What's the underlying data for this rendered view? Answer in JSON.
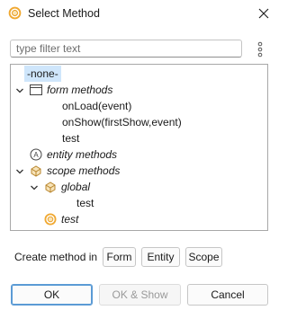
{
  "window": {
    "title": "Select Method",
    "close_icon": "close-icon",
    "app_icon": "ring-icon"
  },
  "filter": {
    "placeholder": "type filter text",
    "value": ""
  },
  "tree": {
    "none": "-none-",
    "form_methods": "form methods",
    "on_load": "onLoad(event)",
    "on_show": "onShow(firstShow,event)",
    "form_test": "test",
    "entity_methods": "entity methods",
    "scope_methods": "scope methods",
    "global": "global",
    "global_test": "test",
    "root_test": "test"
  },
  "create": {
    "label": "Create method in",
    "form": "Form",
    "entity": "Entity",
    "scope": "Scope"
  },
  "footer": {
    "ok": "OK",
    "ok_show": "OK & Show",
    "cancel": "Cancel"
  },
  "colors": {
    "selection": "#cfe6fb",
    "accent": "#5b9bd5",
    "ring": "#f0a830"
  }
}
